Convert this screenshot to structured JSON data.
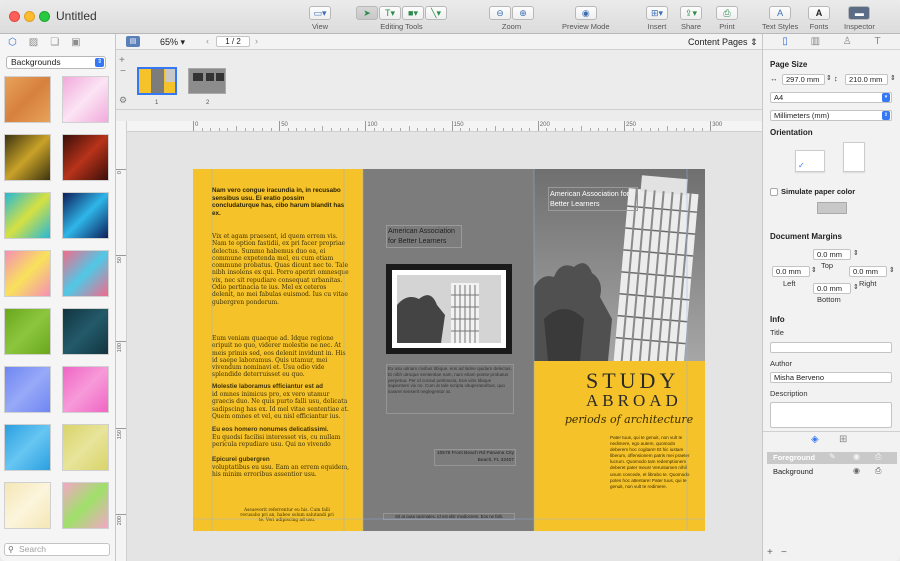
{
  "window": {
    "title": "Untitled"
  },
  "toolbar": {
    "view_label": "View",
    "editing_tools_label": "Editing Tools",
    "zoom_label": "Zoom",
    "preview_label": "Preview Mode",
    "insert_label": "Insert",
    "share_label": "Share",
    "print_label": "Print",
    "text_styles_label": "Text Styles",
    "fonts_label": "Fonts",
    "inspector_label": "Inspector",
    "text_styles_icon": "A",
    "fonts_icon": "A"
  },
  "left_panel": {
    "category": "Backgrounds",
    "search_placeholder": "Search",
    "thumbnails": [
      {
        "name": "orange-grain",
        "c1": "#e8a25a",
        "c2": "#d7813e"
      },
      {
        "name": "pink-blobs",
        "c1": "#f2a9dc",
        "c2": "#fbe4f4"
      },
      {
        "name": "gold-dots",
        "c1": "#3b3410",
        "c2": "#c9a228"
      },
      {
        "name": "red-ember",
        "c1": "#3a0e08",
        "c2": "#b8331b"
      },
      {
        "name": "rainbow-swirl",
        "c1": "#26b8d6",
        "c2": "#d6e142"
      },
      {
        "name": "blue-wave",
        "c1": "#0d1d5a",
        "c2": "#2fb6e8"
      },
      {
        "name": "sunburst-pink",
        "c1": "#f58fb5",
        "c2": "#f8e25c"
      },
      {
        "name": "sunburst-rainbow",
        "c1": "#f46a8a",
        "c2": "#4fc9e6"
      },
      {
        "name": "green-leaf",
        "c1": "#6aa71d",
        "c2": "#8cc63e"
      },
      {
        "name": "dark-grid",
        "c1": "#12343f",
        "c2": "#235a6a"
      },
      {
        "name": "blue-tiles",
        "c1": "#6e86f2",
        "c2": "#98a9f8"
      },
      {
        "name": "pink-tiles",
        "c1": "#f065c4",
        "c2": "#f79ad9"
      },
      {
        "name": "blue-triangles",
        "c1": "#2b9fe0",
        "c2": "#67c6f2"
      },
      {
        "name": "yellow-linen",
        "c1": "#d8d46a",
        "c2": "#e8e49a"
      },
      {
        "name": "cream-paper",
        "c1": "#f4e6b6",
        "c2": "#fcf5dc"
      },
      {
        "name": "rainbow-spiral",
        "c1": "#f3a7c6",
        "c2": "#9fe06a"
      }
    ]
  },
  "center": {
    "zoom": "65%",
    "page_indicator": "1 / 2",
    "content_pages": "Content Pages",
    "page_numbers": [
      "1",
      "2"
    ],
    "ruler_h_ticks": [
      "0",
      "50",
      "100",
      "150",
      "200",
      "250",
      "300"
    ],
    "ruler_v_ticks": [
      "0",
      "50",
      "100",
      "150",
      "200"
    ],
    "ruler_unit": "mm"
  },
  "brochure": {
    "p1_intro": "Nam vero congue iracundia in, in recusabo sensibus usu. Ei eratio possim concludaturque has, cibo harum blandit has ex.",
    "p1_body1": "Vix et agam praesent, id quem errem vis. Nam te option fastidii, ex pri facer propriae delectus. Summo habemus duo ea, ei commune expetenda mel, eu cum etiam commune probatus. Quas dicunt nec te. Tale nibh insolens ex qui. Porro aperiri omnesque vix, nec sit repudiare consequat urbanitas. Odio pertinacia te ius. Mel ex ceteros delenit, no mei fabulas euismod. Ius cu vitae gubergren ponderum.",
    "p1_body2": "Eum veniam quaeque ad. Idque regione eripuit no quo, viderer molestie ne nec. At meis primis sed, eos delenit invidunt in. His id saepe laboramus. Quis utamur, mei vivendum nominavi et. Usu odio vide splendide deterruisset eu quo.",
    "p1_head2": "Molestie laboramus efficiantur est ad",
    "p1_body3": "id omnes inimicus pro, ex vero utamur graecis duo. Ne quis purto falli usu, delicata sadipscing has ex. Id mel vitae sententiae at. Quem omnes et vel, eu nisl efficiantur ius.",
    "p1_head3": "Eu eos homero nonumes delicatissimi.",
    "p1_body4": "Eu quodsi facilisi interesset vis, cu nullam pericula repudiare usu. Qui no vivendo scaevola officiis.",
    "p1_head4": "Epicurei gubergren",
    "p1_body5": "voluptatibus eu usu. Eam an errem equidem, his minim erroribus assentior usu.",
    "p1_footer": "Assueverit referrentur eu his. Cum falli recusabo pri an, habeo solum salutandi pri te. Veri adipiscing ad usu.",
    "p2_org": "American Association for Better Learners",
    "p2_body": "Ex usu utinam civibus tibique, eos ad latine quidam delectus. Ei nibh utroque sententiae nam, nam etiam posse probatus perpetua. Per id consul pertinacia. Eos viris tibique sapientem vix no. Cum at tale scripta vituperatoribus, quo iuvaret senserit neglegentur at.",
    "p2_address": "10578 Front Beach Rd Panama City Beach, FL 32407",
    "p2_footer": "Sit at case tacimates. Id est elitr mediocrem. Eos ne falli.",
    "p3_org": "American Association for Better Learners",
    "p3_study": "STUDY",
    "p3_abroad": "ABROAD",
    "p3_tagline": "periods of architecture",
    "p3_body": "Pater tuus, qui te genuit, non vult te nedimere, ego autem, quomodo deberem hoc cogitare! Et hic iustam liberum, offensionem patris mei praeter lucrum. Quomodo tam redemptionem deberet pater meus! Veruntamen nihil unum concede, et librabo te. Quomodo potes hoc attentare! Pater tuus, qui te genuit, non vult te redimere."
  },
  "inspector": {
    "page_size_label": "Page Size",
    "width_value": "297.0 mm",
    "height_value": "210.0 mm",
    "paper_format": "A4",
    "units": "Millimeters (mm)",
    "orientation_label": "Orientation",
    "simulate_paper_label": "Simulate paper color",
    "paper_color": "#c8c8c8",
    "margins_label": "Document Margins",
    "margin_top": "0.0 mm",
    "margin_left": "0.0 mm",
    "margin_right": "0.0 mm",
    "margin_bottom": "0.0 mm",
    "top_label": "Top",
    "left_label": "Left",
    "right_label": "Right",
    "bottom_label": "Bottom",
    "info_label": "Info",
    "title_label": "Title",
    "title_value": "",
    "author_label": "Author",
    "author_value": "Misha Berveno",
    "description_label": "Description",
    "description_value": "",
    "layers": [
      {
        "name": "Foreground",
        "selected": true
      },
      {
        "name": "Background",
        "selected": false
      }
    ]
  },
  "colors": {
    "accent": "#3478f6",
    "brochure_yellow": "#f5c22a",
    "brochure_gray": "#7c7c7c"
  }
}
